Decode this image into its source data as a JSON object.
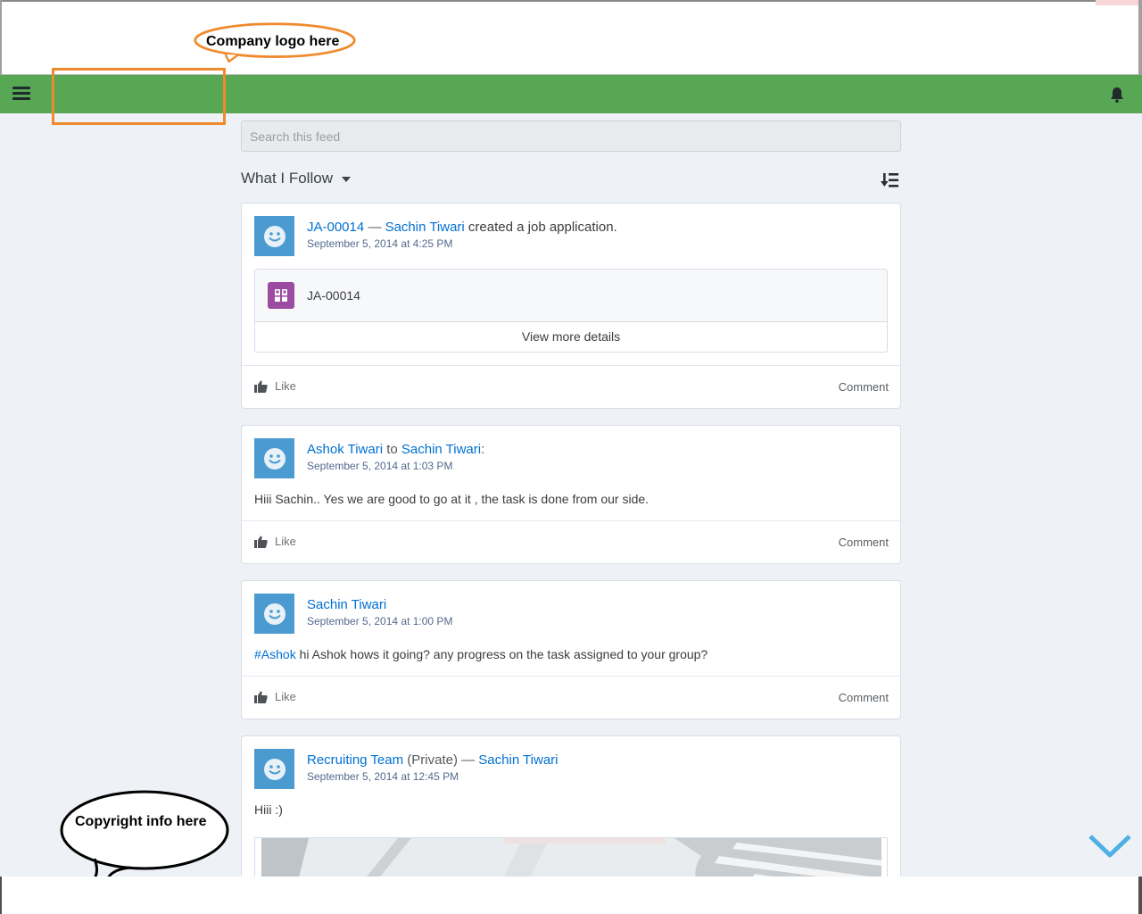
{
  "annotations": {
    "logo_callout": "Company logo here",
    "copyright_callout": "Copyright info here"
  },
  "navbar": {
    "menu_icon": "hamburger-icon",
    "notification_icon": "bell-icon",
    "color": "#58a755"
  },
  "feed": {
    "search_placeholder": "Search this feed",
    "filter_label": "What I Follow",
    "posts": [
      {
        "record_link": "JA-00014",
        "separator": " — ",
        "author": "Sachin Tiwari",
        "action": " created a job application.",
        "timestamp": "September 5, 2014 at 4:25 PM",
        "record_name": "JA-00014",
        "view_more": "View more details",
        "like": "Like",
        "comment": "Comment"
      },
      {
        "author": "Ashok Tiwari",
        "to_word": " to ",
        "recipient": "Sachin Tiwari",
        "colon": ":",
        "timestamp": "September 5, 2014 at 1:03 PM",
        "body": "Hiii Sachin.. Yes we are good to go at it , the task is done from our side.",
        "like": "Like",
        "comment": "Comment"
      },
      {
        "author": "Sachin Tiwari",
        "timestamp": "September 5, 2014 at 1:00 PM",
        "hashtag": "#Ashok",
        "body": " hi Ashok hows it going? any progress on the task assigned to your group?",
        "like": "Like",
        "comment": "Comment"
      },
      {
        "group": "Recruiting Team",
        "privacy": " (Private) — ",
        "author": "Sachin Tiwari",
        "timestamp": "September 5, 2014 at 12:45 PM",
        "body": "Hiii :)"
      }
    ]
  }
}
